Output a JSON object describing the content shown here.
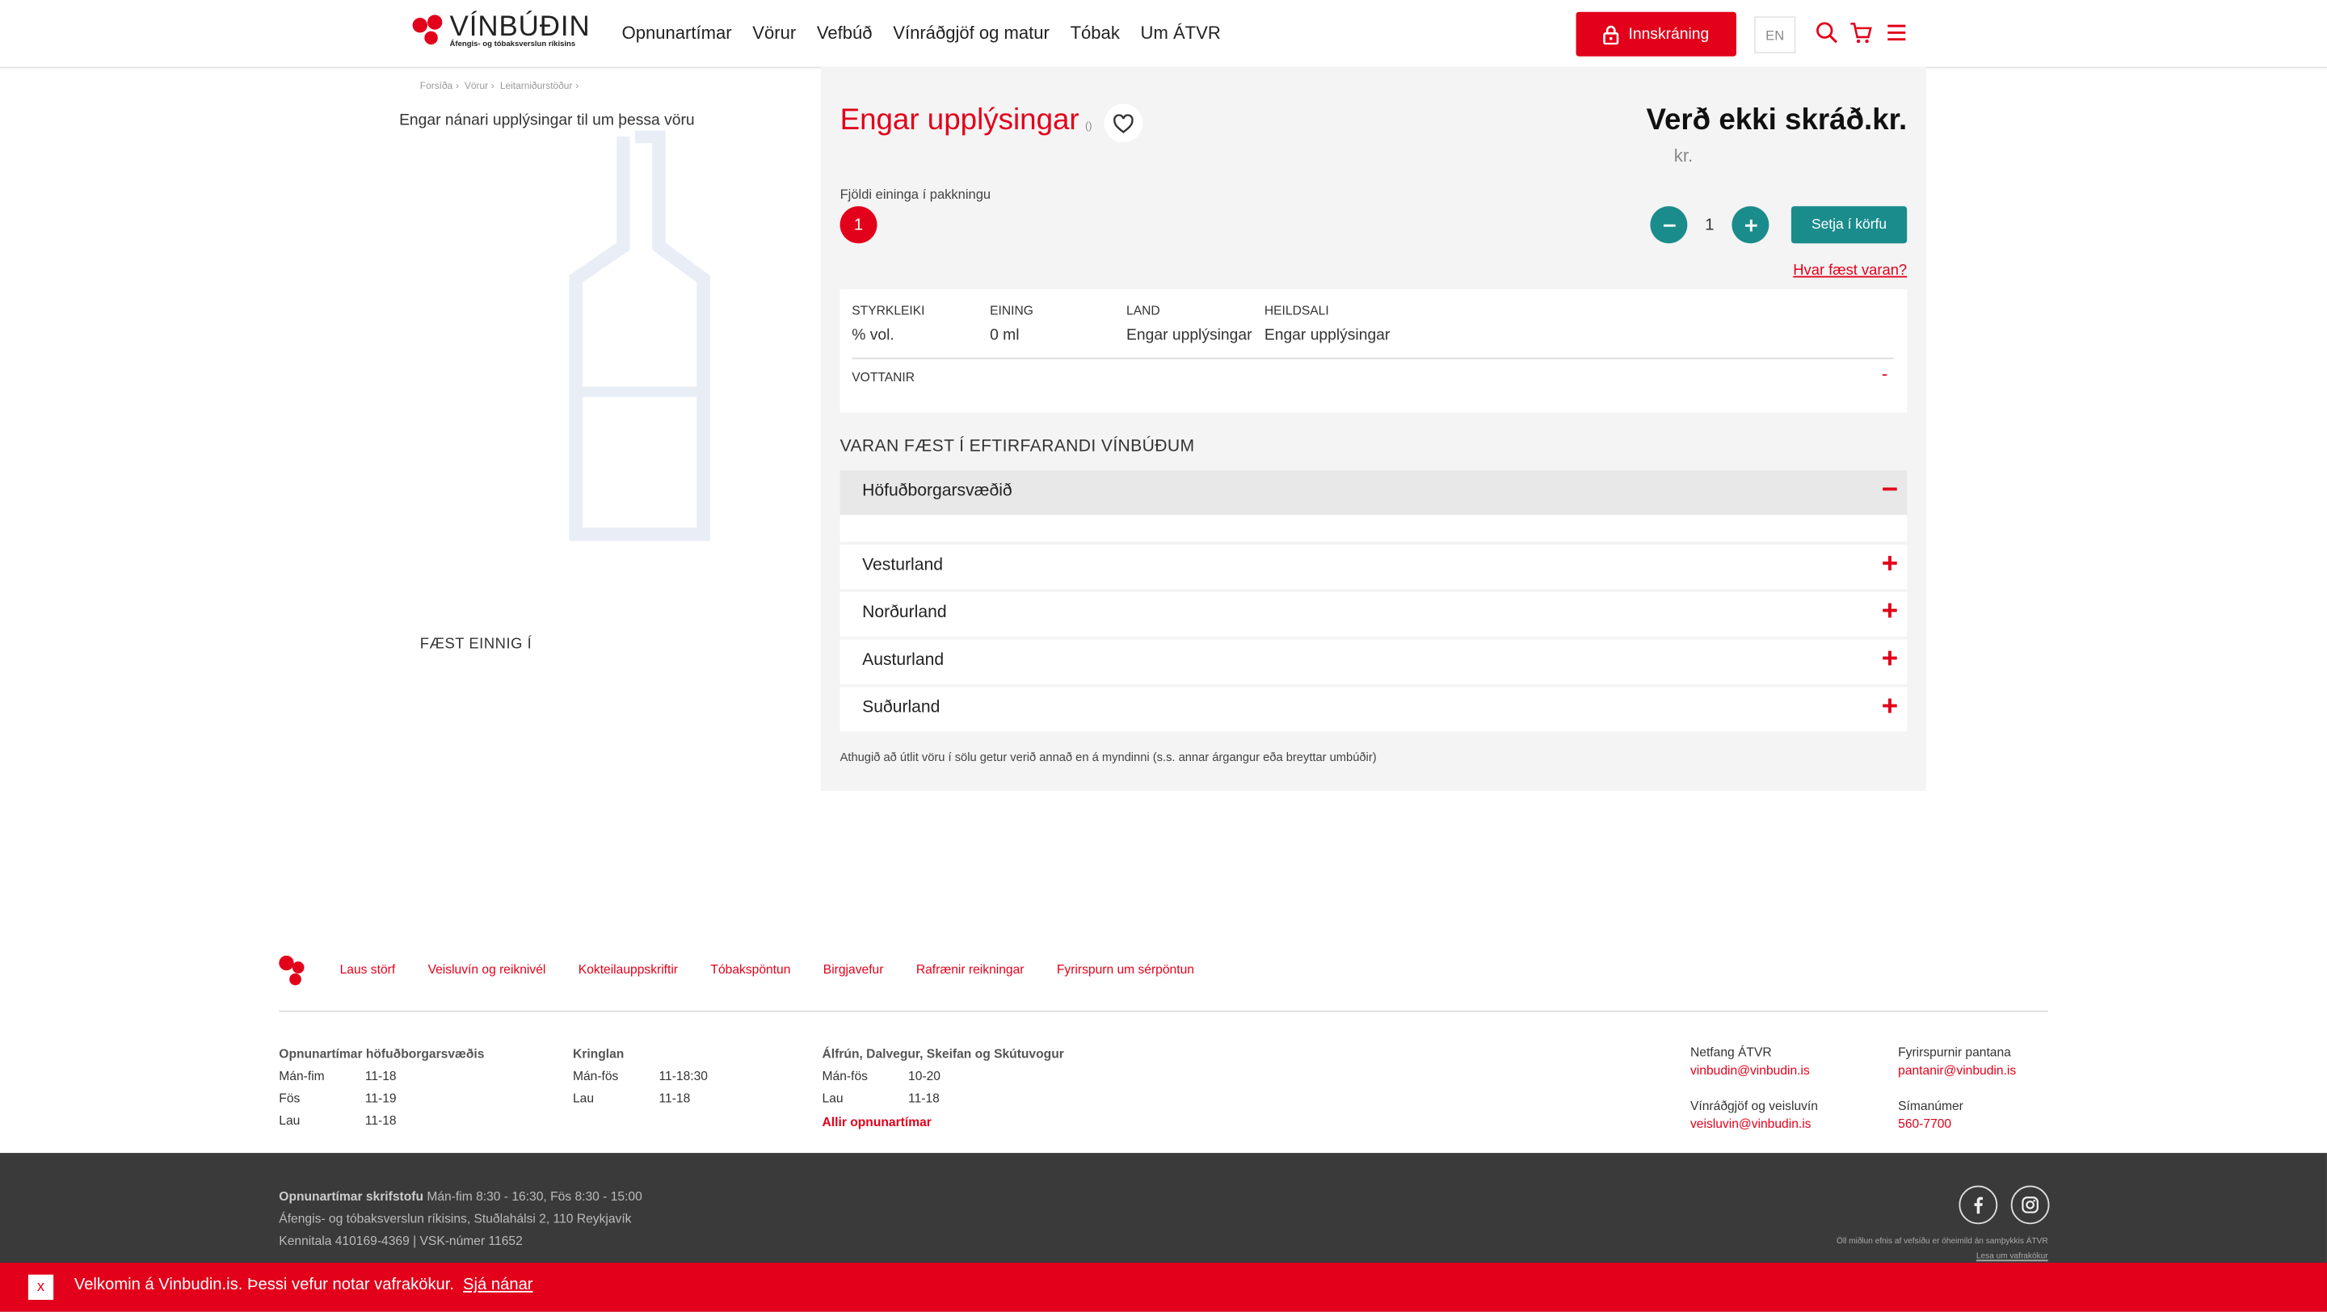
{
  "header": {
    "logo_name": "VÍNBÚÐIN",
    "logo_sub": "Áfengis- og tóbaksverslun ríkisins",
    "nav": [
      "Opnunartímar",
      "Vörur",
      "Vefbúð",
      "Vínráðgjöf og matur",
      "Tóbak",
      "Um ÁTVR"
    ],
    "login_label": "Innskráning",
    "lang_label": "EN",
    "icons": [
      "lock-icon",
      "search-icon",
      "cart-icon",
      "menu-icon"
    ]
  },
  "breadcrumb": [
    "Forsíða",
    "Vörur",
    "Leitarniðurstöður"
  ],
  "product": {
    "no_info_text": "Engar nánari upplýsingar til um þessa vöru",
    "title": "Engar upplýsingar",
    "title_suffix": "()",
    "price": "Verð ekki skráð.kr.",
    "price_sub": "kr.",
    "pack_label": "Fjöldi eininga í pakkningu",
    "pack_value": "1",
    "quantity": "1",
    "add_to_cart": "Setja í körfu",
    "where_sold": "Hvar fæst varan?",
    "also_available": "FÆST EINNIG Í",
    "specs": [
      {
        "label": "STYRKLEIKI",
        "value": "% vol."
      },
      {
        "label": "EINING",
        "value": "0 ml"
      },
      {
        "label": "LAND",
        "value": "Engar upplýsingar"
      },
      {
        "label": "HEILDSALI",
        "value": "Engar upplýsingar"
      }
    ],
    "certifications_label": "VOTTANIR",
    "certifications_sign": "-",
    "availability_heading": "VARAN FÆST Í EFTIRFARANDI VÍNBÚÐUM",
    "regions": [
      {
        "name": "Höfuðborgarsvæðið",
        "sign": "−"
      },
      {
        "name": "Vesturland",
        "sign": "+"
      },
      {
        "name": "Norðurland",
        "sign": "+"
      },
      {
        "name": "Austurland",
        "sign": "+"
      },
      {
        "name": "Suðurland",
        "sign": "+"
      }
    ],
    "note": "Athugið að útlit vöru í sölu getur verið annað en á myndinni (s.s. annar árgangur eða breyttar umbúðir)"
  },
  "footer": {
    "links": [
      "Laus störf",
      "Veisluvín og reiknivél",
      "Kokteilauppskriftir",
      "Tóbakspöntun",
      "Birgjavefur",
      "Rafrænir reikningar",
      "Fyrirspurn um sérpöntun"
    ],
    "hours_capital": {
      "title": "Opnunartímar höfuðborgarsvæðis",
      "rows": [
        [
          "Mán-fim",
          "11-18"
        ],
        [
          "Fös",
          "11-19"
        ],
        [
          "Lau",
          "11-18"
        ]
      ]
    },
    "hours_kringlan": {
      "title": "Kringlan",
      "rows": [
        [
          "Mán-fös",
          "11-18:30"
        ],
        [
          "Lau",
          "11-18"
        ]
      ]
    },
    "hours_other": {
      "title": "Álfrún, Dalvegur, Skeifan og Skútuvogur",
      "rows": [
        [
          "Mán-fös",
          "10-20"
        ],
        [
          "Lau",
          "11-18"
        ]
      ],
      "link": "Allir opnunartímar"
    },
    "contacts": [
      {
        "label": "Netfang ÁTVR",
        "value": "vinbudin@vinbudin.is"
      },
      {
        "label": "Fyrirspurnir pantana",
        "value": "pantanir@vinbudin.is"
      },
      {
        "label": "Vínráðgjöf og veisluvín",
        "value": "veisluvin@vinbudin.is"
      },
      {
        "label": "Símanúmer",
        "value": "560-7700"
      }
    ],
    "office_hours_label": "Opnunartímar skrifstofu",
    "office_hours": "Mán-fim 8:30 - 16:30, Fös 8:30 - 15:00",
    "address": "Áfengis- og tóbaksverslun ríkisins, Stuðlahálsi 2, 110 Reykjavík",
    "ids": "Kennitala 410169-4369 | VSK-númer 11652",
    "copyright": "Öll miðlun efnis af vefsíðu er óheimild án samþykkis ÁTVR",
    "cookie_policy_link": "Lesa um vafrakökur",
    "social": [
      "facebook-icon",
      "instagram-icon"
    ]
  },
  "cookie_bar": {
    "close": "x",
    "message": "Velkomin á Vinbudin.is. Þessi vefur notar vafrakökur.",
    "more": "Sjá nánar"
  },
  "colors": {
    "brand_red": "#e2001a",
    "teal": "#1b8c8c",
    "panel_gray": "#f4f4f4",
    "footer_dark": "#3a3a3a"
  }
}
